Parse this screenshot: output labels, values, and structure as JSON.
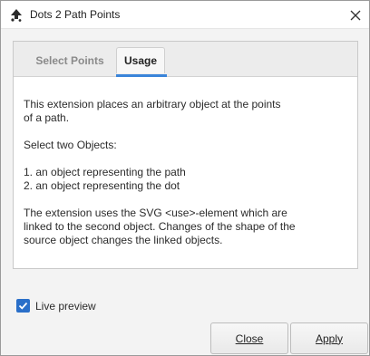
{
  "window": {
    "title": "Dots 2 Path Points"
  },
  "tabs": [
    {
      "label": "Select Points",
      "active": false
    },
    {
      "label": "Usage",
      "active": true
    }
  ],
  "usage": {
    "lines": [
      "This extension places an arbitrary object at the points",
      "of a path.",
      "",
      "Select two Objects:",
      "",
      "1. an object representing the path",
      "2. an object representing the dot",
      "",
      "The extension uses the SVG <use>-element which are",
      "linked to the second object. Changes of the shape of the",
      "source object changes the linked objects."
    ]
  },
  "live_preview": {
    "label": "Live preview",
    "checked": true
  },
  "buttons": {
    "close": "Close",
    "apply": "Apply"
  },
  "colors": {
    "accent": "#3a84d9",
    "checkbox": "#2a6fc9"
  },
  "icons": {
    "app": "inkscape-icon",
    "close": "close-icon",
    "check": "check-icon"
  }
}
